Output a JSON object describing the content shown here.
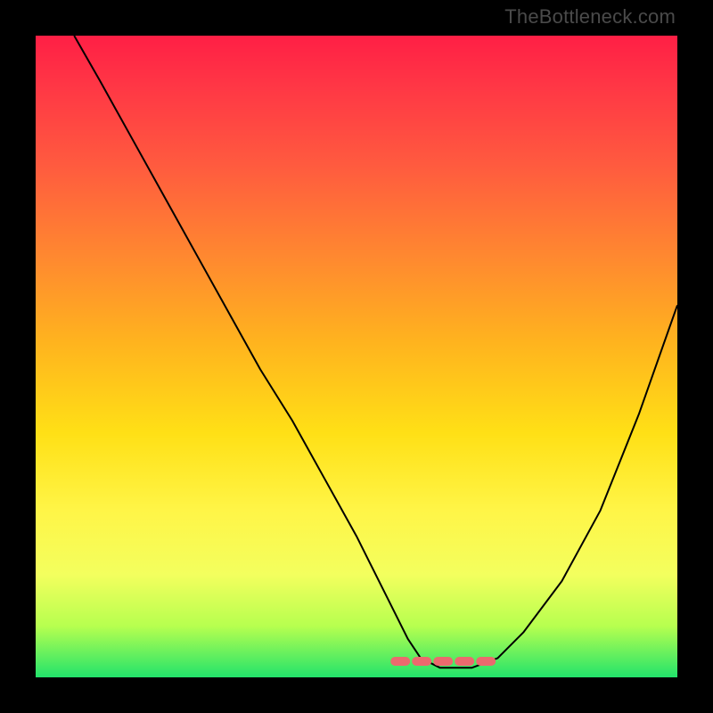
{
  "watermark": "TheBottleneck.com",
  "colors": {
    "gradient_top": "#ff1f45",
    "gradient_mid1": "#ff8a2f",
    "gradient_mid2": "#ffe016",
    "gradient_bottom": "#22e36b",
    "curve": "#000000",
    "marker": "#eb6a6e",
    "frame": "#000000"
  },
  "chart_data": {
    "type": "line",
    "title": "",
    "xlabel": "",
    "ylabel": "",
    "xlim": [
      0,
      100
    ],
    "ylim": [
      0,
      100
    ],
    "grid": false,
    "note": "V-shaped curve on a red-to-green vertical gradient. y values are approximate, read as percentage of plot height from bottom.",
    "series": [
      {
        "name": "curve",
        "x": [
          6,
          10,
          15,
          20,
          25,
          30,
          35,
          40,
          45,
          50,
          52,
          55,
          58,
          60,
          63,
          68,
          72,
          76,
          82,
          88,
          94,
          100
        ],
        "y": [
          100,
          93,
          84,
          75,
          66,
          57,
          48,
          40,
          31,
          22,
          18,
          12,
          6,
          3,
          1.5,
          1.5,
          3,
          7,
          15,
          26,
          41,
          58
        ]
      }
    ],
    "annotations": [
      {
        "name": "valley-marker",
        "kind": "dashed-segment",
        "x_from": 56,
        "x_to": 72,
        "y": 2.5
      }
    ]
  }
}
